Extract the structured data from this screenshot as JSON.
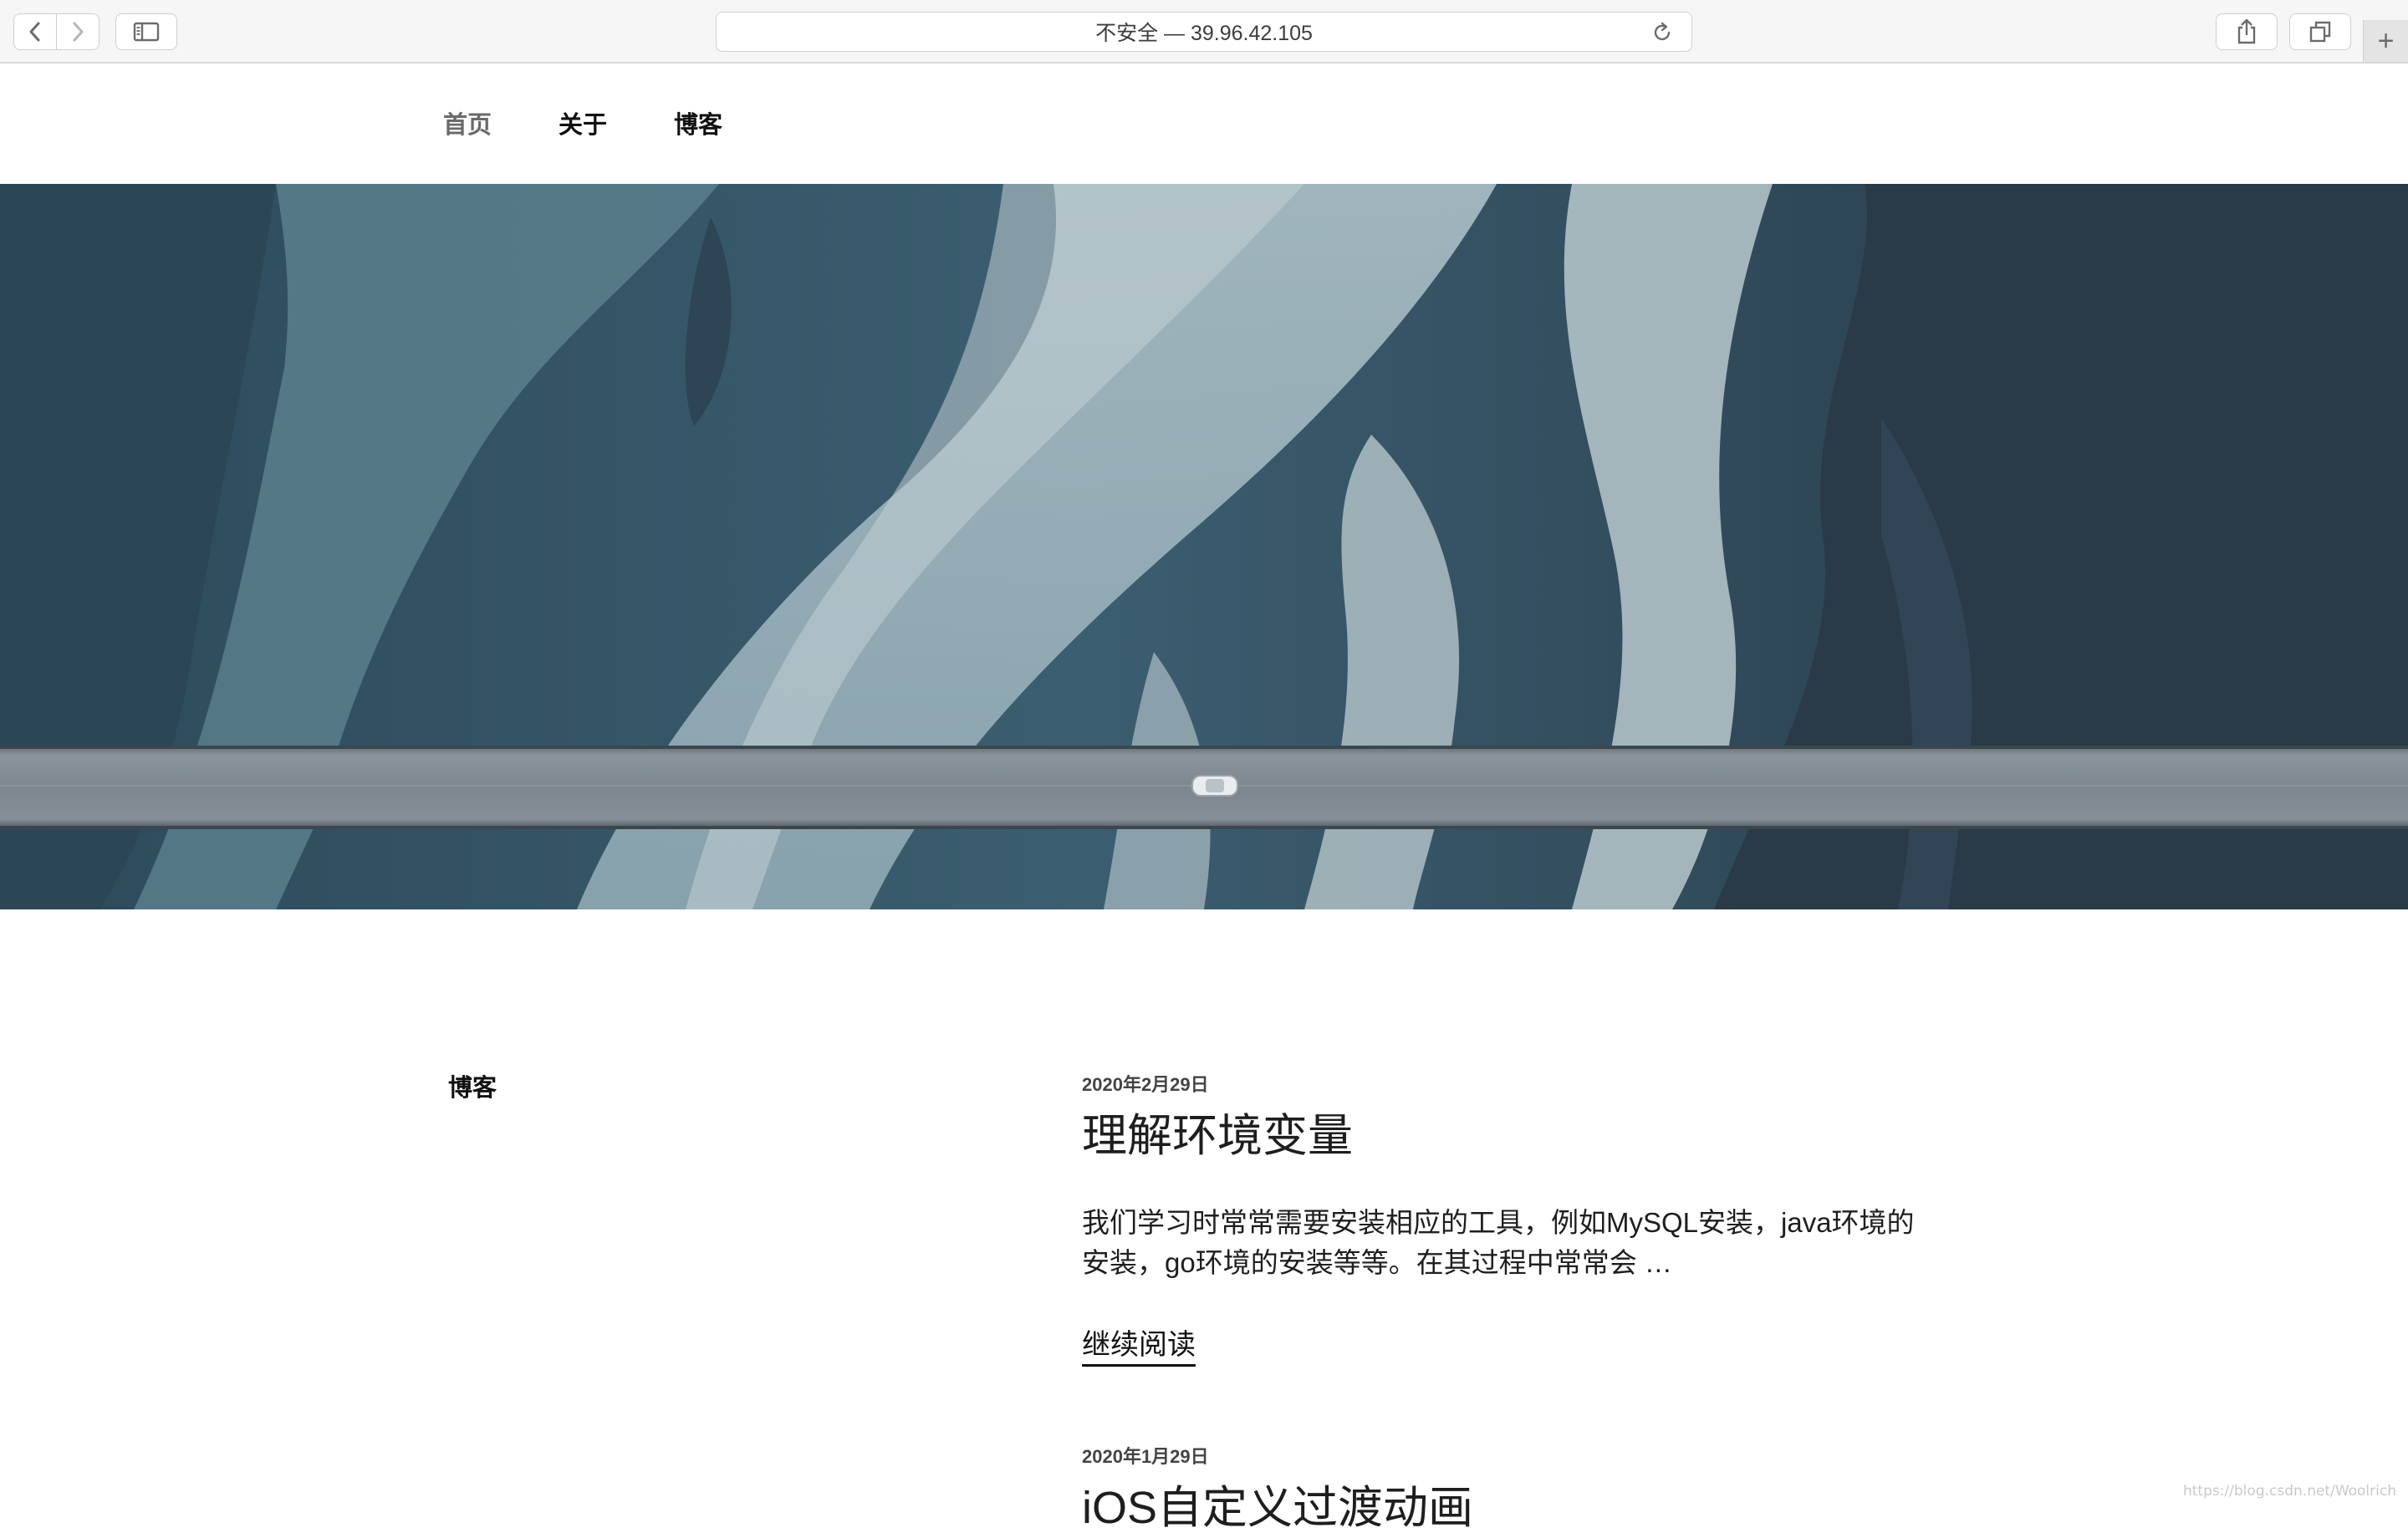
{
  "browser": {
    "address": "不安全 — 39.96.42.105",
    "new_tab_glyph": "+",
    "icons": {
      "back": "chevron-left-icon",
      "forward": "chevron-right-icon",
      "sidebar": "sidebar-icon",
      "reload": "reload-icon",
      "share": "share-icon",
      "tabs": "tabs-overview-icon"
    }
  },
  "site": {
    "nav": [
      {
        "label": "首页",
        "active": true
      },
      {
        "label": "关于",
        "active": false
      },
      {
        "label": "博客",
        "active": false
      }
    ],
    "hero": {
      "subject": "aerial photo of braided glacial river with a bridge and a white car",
      "colors": {
        "water_dark": "#2a4657",
        "water_light": "#a9bdc4",
        "rock": "#26323d",
        "bridge": "#7d8891"
      }
    }
  },
  "content": {
    "section_title": "博客",
    "posts": [
      {
        "date": "2020年2月29日",
        "title": "理解环境变量",
        "excerpt": "我们学习时常常需要安装相应的工具，例如MySQL安装，java环境的安装，go环境的安装等等。在其过程中常常会 …",
        "read_more": "继续阅读"
      },
      {
        "date": "2020年1月29日",
        "title": "iOS自定义过渡动画"
      }
    ]
  },
  "watermark": "https://blog.csdn.net/Woolrich"
}
